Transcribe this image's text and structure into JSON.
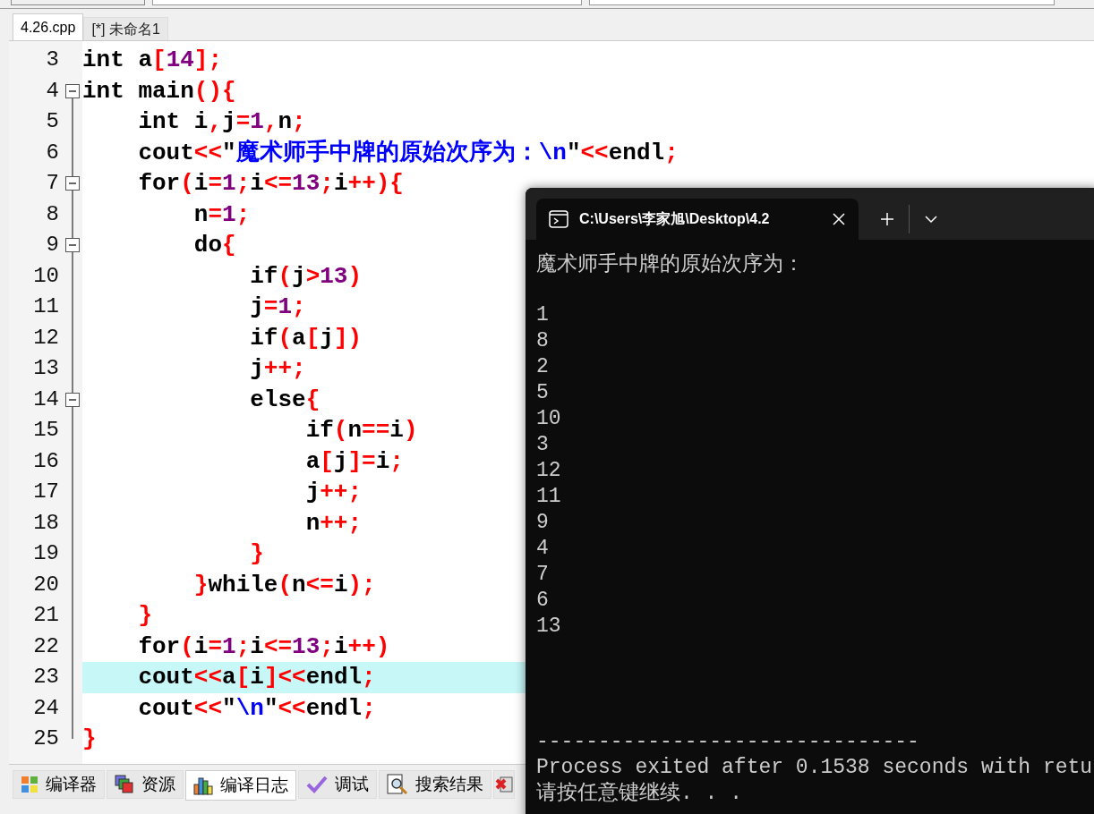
{
  "editor_tabs": [
    {
      "label": "4.26.cpp",
      "selected": true
    },
    {
      "label": "[*] 未命名1",
      "selected": false
    }
  ],
  "code_lines": [
    {
      "number": "3",
      "text": "int a[14];",
      "fold_toggle": false,
      "highlighted": false
    },
    {
      "number": "4",
      "text": "int main(){",
      "fold_toggle": true,
      "highlighted": false
    },
    {
      "number": "5",
      "text": "    int i,j=1,n;",
      "fold_toggle": false,
      "highlighted": false
    },
    {
      "number": "6",
      "text": "    cout<<\"魔术师手中牌的原始次序为：\\n\"<<endl;",
      "fold_toggle": false,
      "highlighted": false
    },
    {
      "number": "7",
      "text": "    for(i=1;i<=13;i++){",
      "fold_toggle": true,
      "highlighted": false
    },
    {
      "number": "8",
      "text": "        n=1;",
      "fold_toggle": false,
      "highlighted": false
    },
    {
      "number": "9",
      "text": "        do{",
      "fold_toggle": true,
      "highlighted": false
    },
    {
      "number": "10",
      "text": "            if(j>13)",
      "fold_toggle": false,
      "highlighted": false
    },
    {
      "number": "11",
      "text": "            j=1;",
      "fold_toggle": false,
      "highlighted": false
    },
    {
      "number": "12",
      "text": "            if(a[j])",
      "fold_toggle": false,
      "highlighted": false
    },
    {
      "number": "13",
      "text": "            j++;",
      "fold_toggle": false,
      "highlighted": false
    },
    {
      "number": "14",
      "text": "            else{",
      "fold_toggle": true,
      "highlighted": false
    },
    {
      "number": "15",
      "text": "                if(n==i)",
      "fold_toggle": false,
      "highlighted": false
    },
    {
      "number": "16",
      "text": "                a[j]=i;",
      "fold_toggle": false,
      "highlighted": false
    },
    {
      "number": "17",
      "text": "                j++;",
      "fold_toggle": false,
      "highlighted": false
    },
    {
      "number": "18",
      "text": "                n++;",
      "fold_toggle": false,
      "highlighted": false
    },
    {
      "number": "19",
      "text": "            }",
      "fold_toggle": false,
      "highlighted": false
    },
    {
      "number": "20",
      "text": "        }while(n<=i);",
      "fold_toggle": false,
      "highlighted": false
    },
    {
      "number": "21",
      "text": "    }",
      "fold_toggle": false,
      "highlighted": false
    },
    {
      "number": "22",
      "text": "    for(i=1;i<=13;i++)",
      "fold_toggle": false,
      "highlighted": false
    },
    {
      "number": "23",
      "text": "    cout<<a[i]<<endl;",
      "fold_toggle": false,
      "highlighted": true
    },
    {
      "number": "24",
      "text": "    cout<<\"\\n\"<<endl;",
      "fold_toggle": false,
      "highlighted": false
    },
    {
      "number": "25",
      "text": "}",
      "fold_toggle": false,
      "highlighted": false
    }
  ],
  "bottom_tabs": [
    {
      "label": "编译器",
      "kind": "grid",
      "selected": false
    },
    {
      "label": "资源",
      "kind": "squares",
      "selected": false
    },
    {
      "label": "编译日志",
      "kind": "bars",
      "selected": true
    },
    {
      "label": "调试",
      "kind": "check",
      "selected": false
    },
    {
      "label": "搜索结果",
      "kind": "search",
      "selected": false
    },
    {
      "kind": "cross",
      "selected": false
    }
  ],
  "console": {
    "tab_title": "C:\\Users\\李家旭\\Desktop\\4.2",
    "heading": "魔术师手中牌的原始次序为：",
    "output": [
      "1",
      "8",
      "2",
      "5",
      "10",
      "3",
      "12",
      "11",
      "9",
      "4",
      "7",
      "6",
      "13"
    ],
    "separator": "-------------------------------",
    "footer": [
      "Process exited after 0.1538 seconds with retu",
      "请按任意键继续. . ."
    ]
  }
}
